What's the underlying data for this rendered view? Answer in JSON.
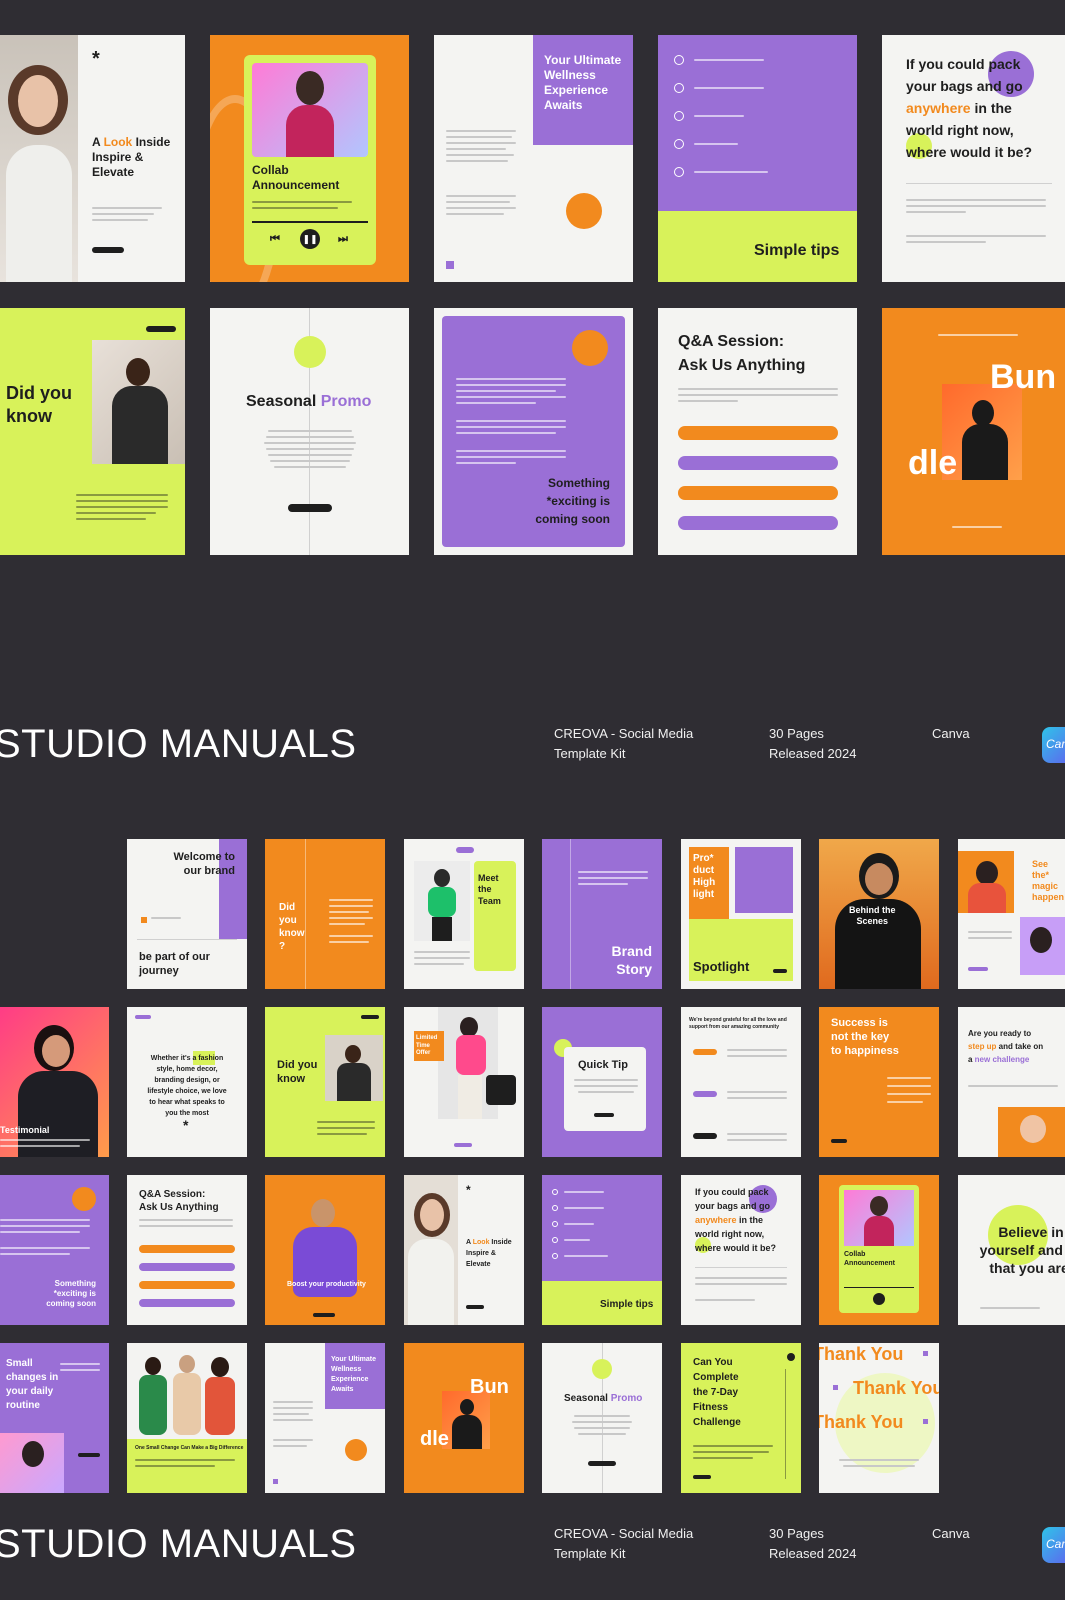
{
  "top_cards": {
    "look_inside": {
      "prefix": "A ",
      "look": "Look",
      "rest": " Inside\nInspire &\nElevate",
      "star": "*"
    },
    "collab": {
      "title": "Collab\nAnnouncement"
    },
    "wellness": {
      "title": "Your Ultimate\nWellness\nExperience\nAwaits"
    },
    "simple_tips": {
      "title": "Simple tips"
    },
    "pack_bags": {
      "l1": "If you could pack",
      "l2": "your bags and go",
      "l3a": "anywhere",
      "l3b": " in the",
      "l4": "world right now,",
      "l5a": "where",
      "l5b": " would it be?"
    },
    "did_you_know": {
      "title": "Did you\nknow"
    },
    "seasonal": {
      "a": "Seasonal ",
      "b": "Promo"
    },
    "something": {
      "title": "Something\n*exciting is\ncoming soon"
    },
    "qa": {
      "title": "Q&A Session:\nAsk Us Anything"
    },
    "bundle": {
      "a": "Bun",
      "b": "dle"
    }
  },
  "footers": [
    {
      "title": "STUDIO MANUALS",
      "product": "CREOVA - Social Media\nTemplate Kit",
      "pages": "30 Pages\nReleased 2024",
      "platform": "Canva",
      "badge": "Canva"
    },
    {
      "title": "STUDIO MANUALS",
      "product": "CREOVA - Social Media\nTemplate Kit",
      "pages": "30 Pages\nReleased 2024",
      "platform": "Canva",
      "badge": "Canva"
    }
  ],
  "grid": {
    "welcome": "Welcome to\nour brand",
    "journey": "be part of our\njourney",
    "did_q": "Did\nyou\nknow\n?",
    "meet_team": "Meet\nthe\nTeam",
    "brand_story": "Brand\nStory",
    "product_highlight": "Pro*\nduct\nHigh\nlight",
    "spotlight": "Spotlight",
    "behind": "Behind the\nScenes",
    "see_magic": "See\nthe*\nmagic\nhappen",
    "testimonial": "Testimonial",
    "fashion": "Whether it's a fashion\nstyle, home decor,\nbranding design, or\nlifestyle choice, we love\nto hear what speaks to\nyou the most",
    "did_you_know2": "Did you\nknow",
    "limited": "Limited\nTime\nOffer",
    "quick_tip": "Quick Tip",
    "grateful": "We're beyond grateful for all the love and support from our amazing community",
    "success": "Success is\nnot the key\nto happiness",
    "ready": {
      "a": "Are you ready to",
      "b": "step up",
      "c": " and take on",
      "d": "a ",
      "e": "new challenge"
    },
    "something2": "Something\n*exciting is\ncoming soon",
    "qa2": "Q&A Session:\nAsk Us Anything",
    "boost": "Boost your productivity",
    "look2": {
      "a": "A ",
      "b": "Look",
      "c": " Inside\nInspire &\nElevate"
    },
    "simple_tips2": "Simple tips",
    "pack2": {
      "l1": "If you could pack",
      "l2": "your bags and go",
      "l3a": "anywhere",
      "l3b": " in the",
      "l4": "world right now,",
      "l5a": "where",
      "l5b": " would it be?"
    },
    "collab2": "Collab\nAnnouncement",
    "believe": "Believe in\nyourself and all\nthat you are.",
    "small_changes": "Small\nchanges in\nyour daily\nroutine",
    "one_small": "One Small Change Can Make a Big Difference",
    "wellness2": "Your Ultimate\nWellness\nExperience\nAwaits",
    "bundle2": {
      "a": "Bun",
      "b": "dle"
    },
    "seasonal2": {
      "a": "Seasonal ",
      "b": "Promo"
    },
    "fitness": "Can You\nComplete\nthe 7-Day\nFitness\nChallenge",
    "thank": "Thank You"
  },
  "colors": {
    "purple": "#9a6fd6",
    "orange": "#f28a1e",
    "lime": "#d8f25a",
    "dark": "#2f2d33",
    "paper": "#f4f4f2"
  }
}
